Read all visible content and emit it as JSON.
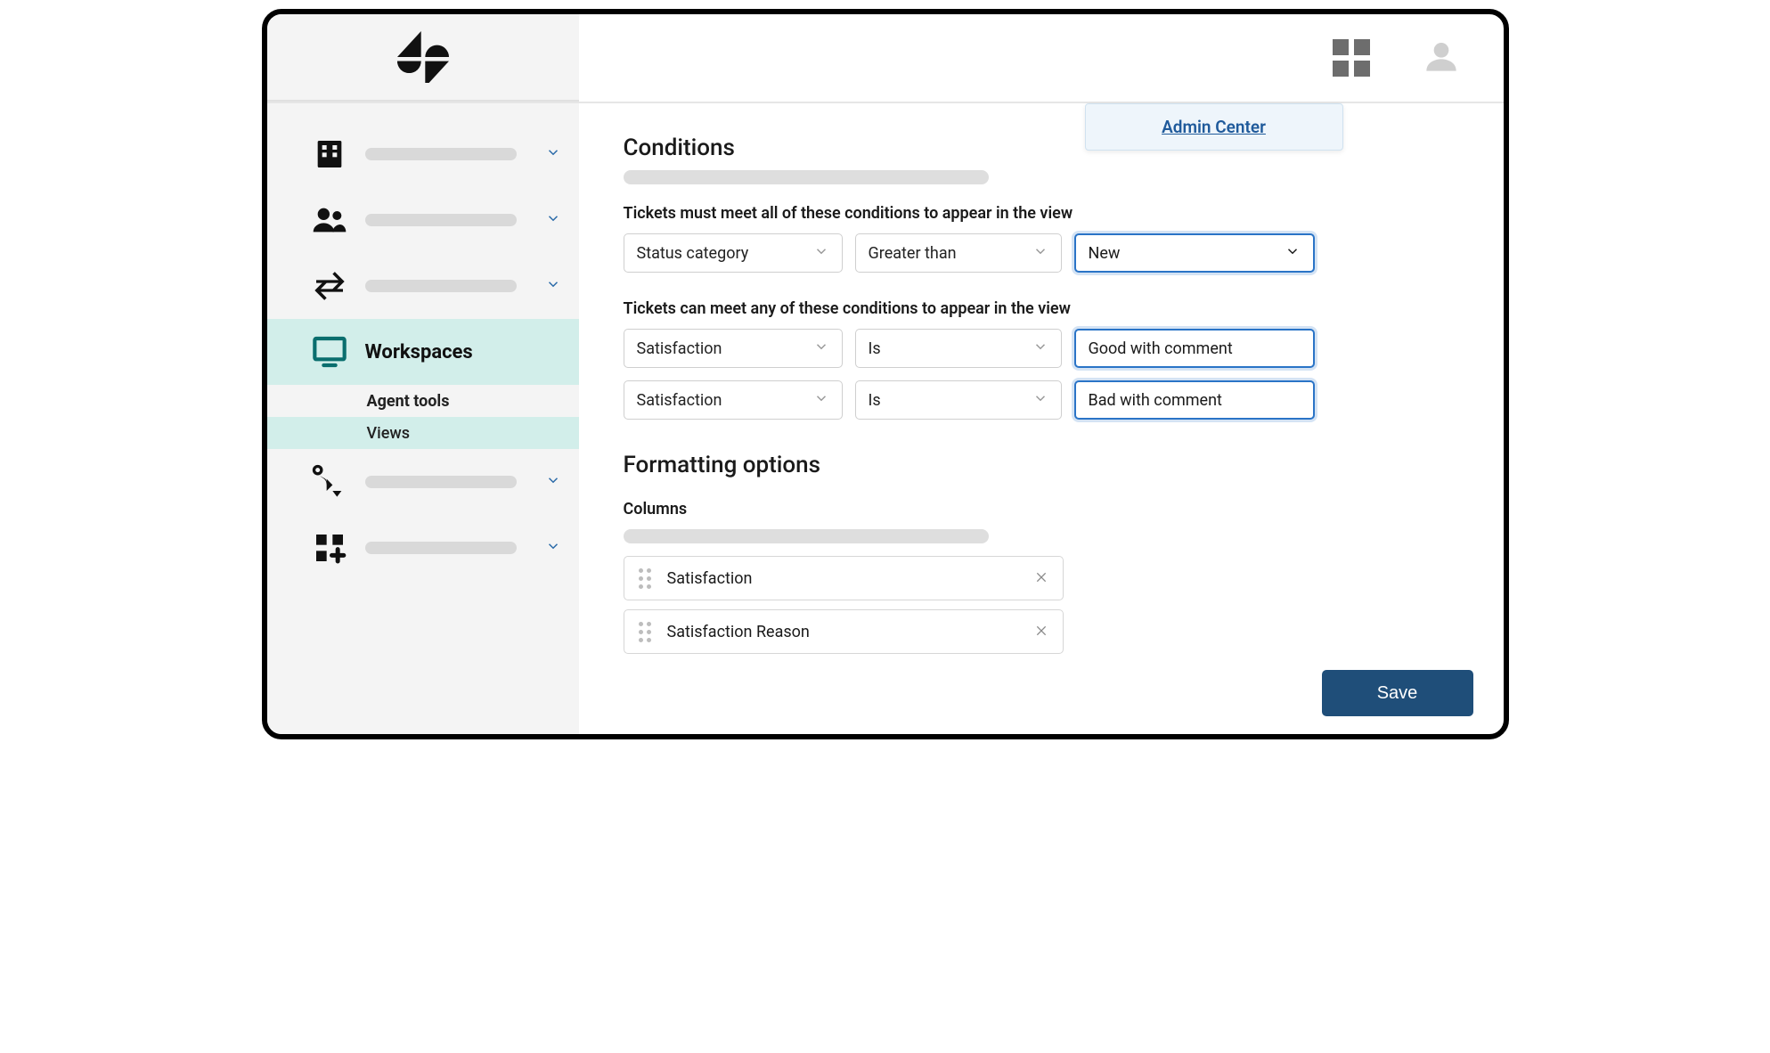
{
  "popover": {
    "link": "Admin Center"
  },
  "sidebar": {
    "active_label": "Workspaces",
    "sub": {
      "agent_tools": "Agent tools",
      "views": "Views"
    }
  },
  "sections": {
    "conditions": "Conditions",
    "formatting": "Formatting options",
    "columns_label": "Columns"
  },
  "cond_all_label": "Tickets must meet all of these conditions to appear in the view",
  "cond_any_label": "Tickets can meet any of these conditions to appear in the view",
  "all_rows": [
    {
      "col": "Status category",
      "op": "Greater than",
      "val": "New"
    }
  ],
  "any_rows": [
    {
      "col": "Satisfaction",
      "op": "Is",
      "val": "Good with comment"
    },
    {
      "col": "Satisfaction",
      "op": "Is",
      "val": "Bad with comment"
    }
  ],
  "columns": [
    {
      "name": "Satisfaction"
    },
    {
      "name": "Satisfaction Reason"
    }
  ],
  "buttons": {
    "save": "Save"
  }
}
